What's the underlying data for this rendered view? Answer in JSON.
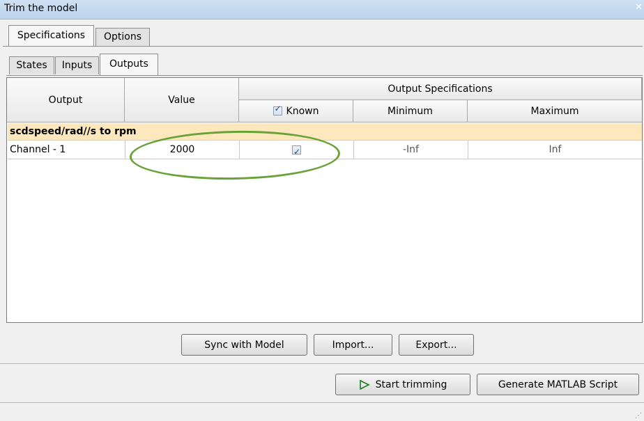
{
  "window": {
    "title": "Trim the model"
  },
  "tabs": {
    "main": [
      {
        "label": "Specifications"
      },
      {
        "label": "Options"
      }
    ],
    "sub": [
      {
        "label": "States"
      },
      {
        "label": "Inputs"
      },
      {
        "label": "Outputs"
      }
    ]
  },
  "table": {
    "headers": {
      "output": "Output",
      "value": "Value",
      "group": "Output Specifications",
      "known": "Known",
      "minimum": "Minimum",
      "maximum": "Maximum"
    },
    "group_label": "scdspeed/rad//s to rpm",
    "rows": [
      {
        "output": "Channel - 1",
        "value": "2000",
        "known": true,
        "minimum": "-Inf",
        "maximum": "Inf"
      }
    ]
  },
  "buttons": {
    "sync": "Sync with Model",
    "import": "Import...",
    "export": "Export...",
    "start": "Start trimming",
    "generate": "Generate MATLAB Script"
  },
  "colors": {
    "highlight": "#6aa23a",
    "group_row": "#fde8be"
  }
}
